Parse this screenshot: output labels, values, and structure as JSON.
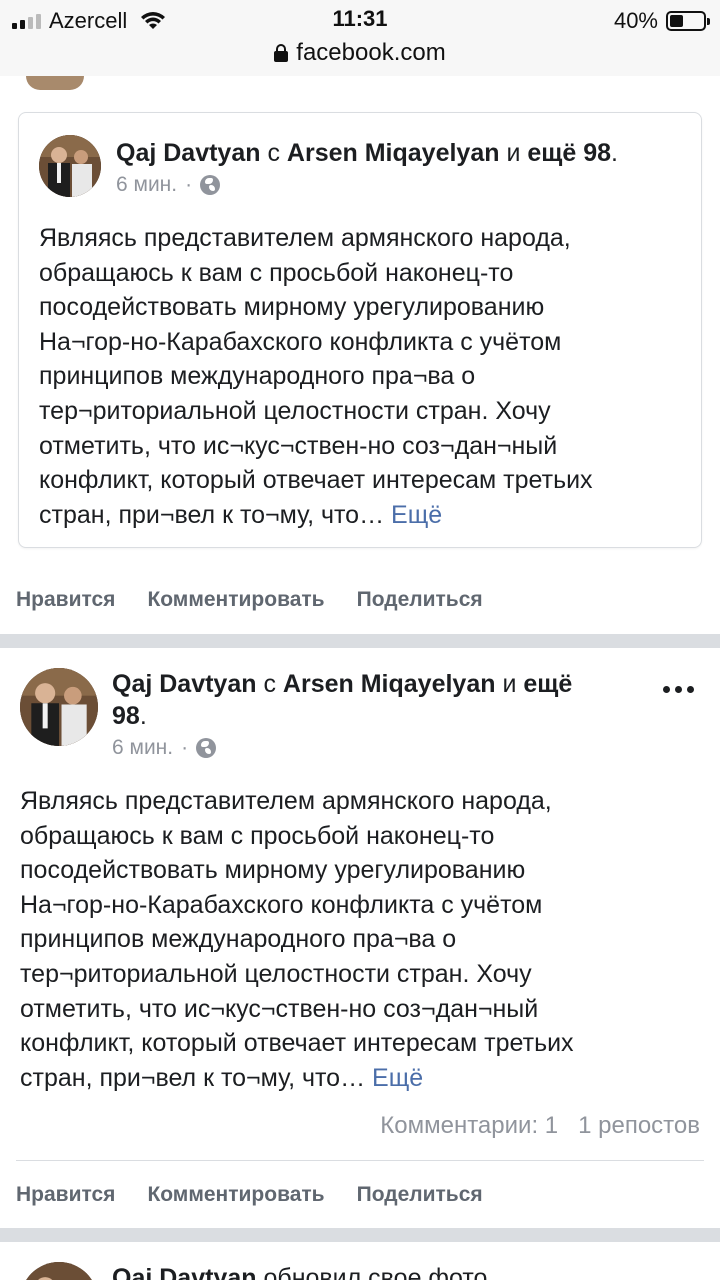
{
  "status_bar": {
    "carrier": "Azercell",
    "time": "11:31",
    "battery": "40%",
    "battery_level": 0.4
  },
  "url_bar": {
    "domain": "facebook.com"
  },
  "shared_post": {
    "author": "Qaj Davtyan",
    "with_word": "с",
    "tagged": "Arsen Miqayelyan",
    "and_word": "и",
    "others": "ещё 98",
    "time": "6 мин.",
    "separator": "·",
    "text": "Являясь представителем армянского народа,\nобращаюсь к вам с просьбой наконец-то\nпосодействовать мирному урегулированию\nНа¬гор-но-Карабахского конфликта с учётом\nпринципов международного пра¬ва о\nтер¬риториальной целостности стран. Хочу\nотметить, что ис¬кус¬ствен-но соз¬дан¬ный\nконфликт, который отвечает интересам третьих\nстран, при¬вел к то¬му, что…",
    "more": "Ещё"
  },
  "actions_1": {
    "like": "Нравится",
    "comment": "Комментировать",
    "share": "Поделиться"
  },
  "post": {
    "author": "Qaj Davtyan",
    "with_word": "с",
    "tagged": "Arsen Miqayelyan",
    "and_word": "и",
    "others_line1": "ещё",
    "others_line2": "98",
    "time": "6 мин.",
    "separator": "·",
    "text": "Являясь представителем армянского народа,\nобращаюсь к вам с просьбой наконец-то\nпосодействовать мирному урегулированию\nНа¬гор-но-Карабахского конфликта с учётом\nпринципов международного пра¬ва о\nтер¬риториальной целостности стран. Хочу\nотметить, что ис¬кус¬ствен-но соз¬дан¬ный\nконфликт, который отвечает интересам третьих\nстран, при¬вел к то¬му, что…",
    "more": "Ещё",
    "comments": "Комментарии: 1",
    "shares": "1 репостов"
  },
  "actions_2": {
    "like": "Нравится",
    "comment": "Комментировать",
    "share": "Поделиться"
  },
  "next_post": {
    "author": "Qaj Davtyan",
    "action": "обновил свое фото"
  },
  "colors": {
    "link": "#4b6ea9",
    "meta": "#90949c",
    "action": "#606770",
    "divider": "#dadde1"
  }
}
